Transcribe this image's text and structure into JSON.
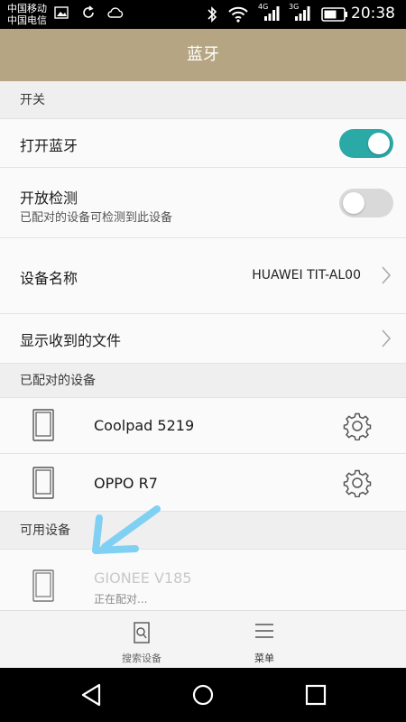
{
  "status_bar": {
    "carrier_1": "中国移动",
    "carrier_2": "中国电信",
    "net_1": "4G",
    "net_2": "3G",
    "time": "20:38",
    "icons": [
      "image-icon",
      "sync-icon",
      "cloud-icon",
      "bluetooth-icon",
      "wifi-icon",
      "signal-icon",
      "signal-icon",
      "battery-icon"
    ]
  },
  "header": {
    "title": "蓝牙"
  },
  "sections": {
    "switch": "开关",
    "paired": "已配对的设备",
    "available": "可用设备"
  },
  "settings": {
    "bluetooth_label": "打开蓝牙",
    "bluetooth_on": true,
    "discover_label": "开放检测",
    "discover_sub": "已配对的设备可检测到此设备",
    "discover_on": false,
    "device_name_label": "设备名称",
    "device_name_value": "HUAWEI TIT-AL00",
    "received_files_label": "显示收到的文件"
  },
  "paired_devices": [
    {
      "name": "Coolpad 5219"
    },
    {
      "name": "OPPO R7"
    }
  ],
  "available_devices": [
    {
      "name": "GIONEE V185",
      "status": "正在配对..."
    }
  ],
  "toolbar": {
    "search_label": "搜索设备",
    "menu_label": "菜单"
  },
  "colors": {
    "header_bg": "#b6a582",
    "toggle_on": "#2aa9a7",
    "toggle_off": "#d9d9d9",
    "annotation_arrow": "#7fd0f2"
  }
}
